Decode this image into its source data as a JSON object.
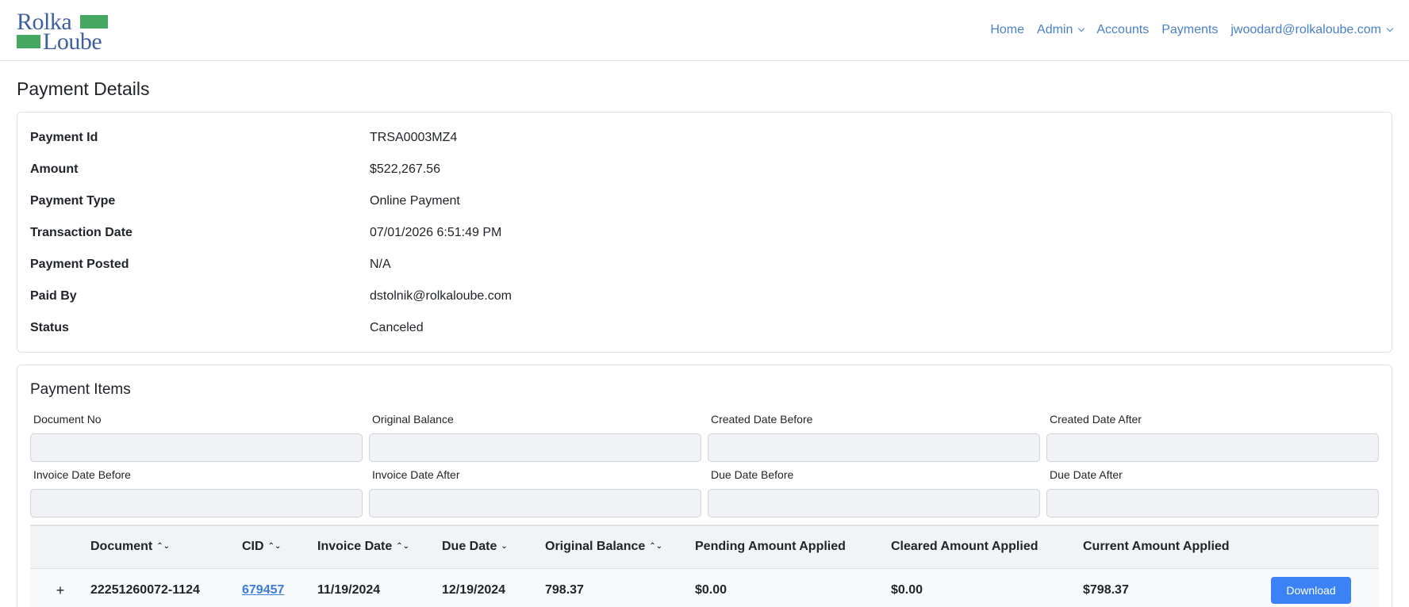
{
  "brand": {
    "line1": "Rolka",
    "line2": "Loube",
    "accent": "#44a863",
    "text_color": "#3f5fa0"
  },
  "nav": {
    "home": "Home",
    "admin": "Admin",
    "accounts": "Accounts",
    "payments": "Payments",
    "user": "jwoodard@rolkaloube.com"
  },
  "page": {
    "title": "Payment Details"
  },
  "details": {
    "payment_id": {
      "label": "Payment Id",
      "value": "TRSA0003MZ4"
    },
    "amount": {
      "label": "Amount",
      "value": "$522,267.56"
    },
    "payment_type": {
      "label": "Payment Type",
      "value": "Online Payment"
    },
    "transaction_date": {
      "label": "Transaction Date",
      "value": "07/01/2026 6:51:49 PM"
    },
    "payment_posted": {
      "label": "Payment Posted",
      "value": "N/A"
    },
    "paid_by": {
      "label": "Paid By",
      "value": "dstolnik@rolkaloube.com"
    },
    "status": {
      "label": "Status",
      "value": "Canceled"
    }
  },
  "items": {
    "title": "Payment Items",
    "filters": {
      "document_no": {
        "label": "Document No",
        "value": ""
      },
      "original_balance": {
        "label": "Original Balance",
        "value": ""
      },
      "created_before": {
        "label": "Created Date Before",
        "value": ""
      },
      "created_after": {
        "label": "Created Date After",
        "value": ""
      },
      "invoice_before": {
        "label": "Invoice Date Before",
        "value": ""
      },
      "invoice_after": {
        "label": "Invoice Date After",
        "value": ""
      },
      "due_before": {
        "label": "Due Date Before",
        "value": ""
      },
      "due_after": {
        "label": "Due Date After",
        "value": ""
      }
    },
    "columns": {
      "document": "Document",
      "cid": "CID",
      "invoice_date": "Invoice Date",
      "due_date": "Due Date",
      "original_balance": "Original Balance",
      "pending": "Pending Amount Applied",
      "cleared": "Cleared Amount Applied",
      "current": "Current Amount Applied"
    },
    "sort_glyphs": {
      "both": "⌃⌄",
      "down": "⌄"
    },
    "rows": [
      {
        "expand": "+",
        "document": "22251260072-1124",
        "cid": "679457",
        "invoice_date": "11/19/2024",
        "due_date": "12/19/2024",
        "original_balance": "798.37",
        "pending": "$0.00",
        "cleared": "$0.00",
        "current": "$798.37",
        "action": "Download"
      }
    ]
  }
}
